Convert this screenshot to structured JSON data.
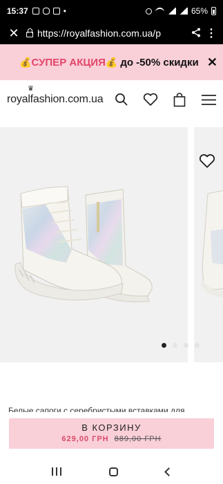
{
  "status_bar": {
    "time": "15:37",
    "battery": "65%"
  },
  "browser": {
    "url": "https://royalfashion.com.ua/p"
  },
  "promo": {
    "emoji": "💰",
    "highlight": "СУПЕР АКЦИЯ",
    "text": "до -50% скидки"
  },
  "header": {
    "logo": "royalfashion.com.ua"
  },
  "gallery": {
    "slides": 4,
    "active_index": 0
  },
  "product": {
    "description": "Белые сапоги с серебристыми вставками для"
  },
  "cart": {
    "label": "В КОРЗИНУ",
    "price_new": "629,00 ГРН",
    "price_old": "889,00 ГРН"
  },
  "colors": {
    "promo_bg": "#f9cfd8",
    "accent": "#e3466a",
    "slide_bg": "#f1f1f1"
  }
}
